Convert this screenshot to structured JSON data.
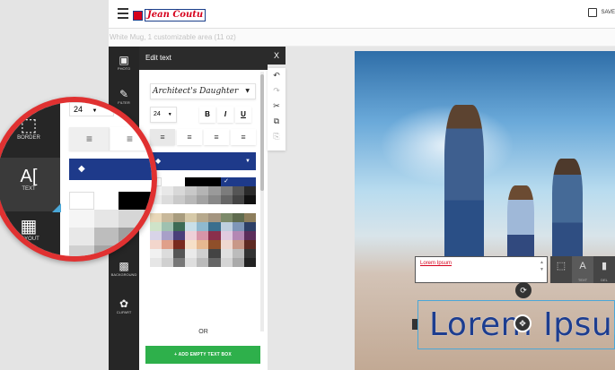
{
  "header": {
    "brand": "Jean Coutu",
    "save_label": "SAVE"
  },
  "subtitle": "White Mug, 1 customizable area (11 oz)",
  "rail": {
    "items": [
      {
        "label": "PHOTO",
        "icon": "photo-icon"
      },
      {
        "label": "FILTER",
        "icon": "magic-wand-icon"
      },
      {
        "label": "BACKGROUND",
        "icon": "background-icon"
      },
      {
        "label": "CLIPART",
        "icon": "clipart-icon"
      }
    ]
  },
  "magnifier": {
    "items": [
      {
        "label": "BORDER",
        "icon": "border-icon",
        "glyph": "⬚"
      },
      {
        "label": "TEXT",
        "icon": "text-icon",
        "glyph": "A["
      },
      {
        "label": "LAYOUT",
        "icon": "layout-icon",
        "glyph": "▦"
      }
    ],
    "size_value": "24",
    "active_item": "TEXT"
  },
  "panel": {
    "title": "Edit text",
    "font_value": "Architect's Daughter",
    "size_value": "24",
    "bold_label": "B",
    "italic_label": "I",
    "underline_label": "U",
    "align_active": "left",
    "or_label": "OR",
    "add_button_label": "+ ADD EMPTY TEXT BOX"
  },
  "close_label": "X",
  "toolbar": {
    "tools": [
      {
        "icon": "undo-icon",
        "glyph": "↶",
        "enabled": true
      },
      {
        "icon": "redo-icon",
        "glyph": "↷",
        "enabled": false
      },
      {
        "icon": "cut-icon",
        "glyph": "✂",
        "enabled": true
      },
      {
        "icon": "copy-icon",
        "glyph": "⧉",
        "enabled": true
      },
      {
        "icon": "paste-icon",
        "glyph": "⎘",
        "enabled": false
      }
    ]
  },
  "textbox_value": "Lorem Ipsum",
  "edit_mini": {
    "text_label": "TEXT",
    "delete_label": "DEL"
  },
  "canvas_text": "Lorem Ipsum",
  "colors": {
    "accent_blue": "#1e3a8a",
    "brand_red": "#d6001c",
    "add_green": "#2eb04b",
    "magnifier_ring": "#e03131"
  }
}
